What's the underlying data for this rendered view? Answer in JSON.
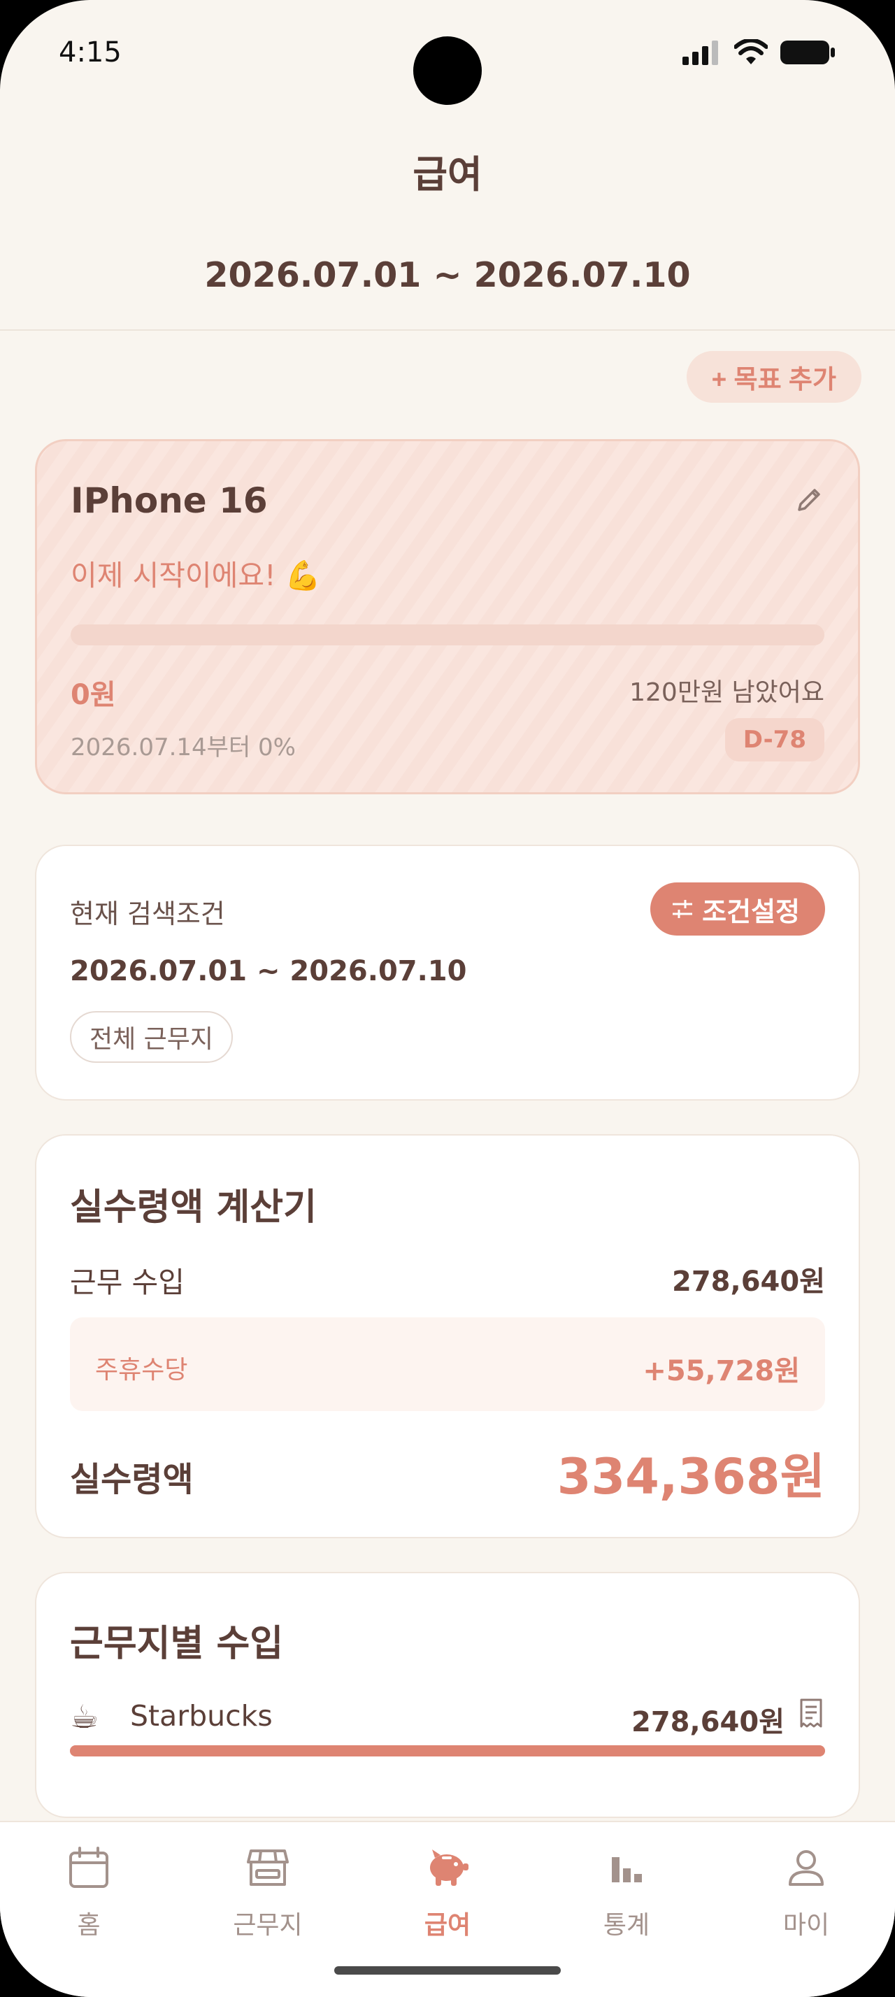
{
  "status": {
    "time": "4:15"
  },
  "header": {
    "title": "급여",
    "period": "2026.07.01 ~ 2026.07.10"
  },
  "goal": {
    "add_button": "+ 목표 추가",
    "name": "IPhone 16",
    "message": "이제 시작이에요! 💪",
    "progress_percent": 0,
    "current": "0원",
    "remaining": "120만원 남았어요",
    "start_info": "2026.07.14부터  0%",
    "dday": "D-78"
  },
  "filter": {
    "label": "현재 검색조건",
    "button": "조건설정",
    "range": "2026.07.01 ~ 2026.07.10",
    "chip": "전체 근무지"
  },
  "calculator": {
    "title": "실수령액 계산기",
    "work_income_label": "근무 수입",
    "work_income_value": "278,640원",
    "allowance_label": "주휴수당",
    "allowance_value": "+55,728원",
    "net_label": "실수령액",
    "net_value": "334,368원"
  },
  "workplace_income": {
    "title": "근무지별 수입",
    "items": [
      {
        "icon": "☕",
        "name": "Starbucks",
        "amount": "278,640원",
        "share_percent": 100
      }
    ]
  },
  "tabs": [
    {
      "label": "홈",
      "icon": "calendar-icon",
      "active": false
    },
    {
      "label": "근무지",
      "icon": "store-icon",
      "active": false
    },
    {
      "label": "급여",
      "icon": "piggy-bank-icon",
      "active": true
    },
    {
      "label": "통계",
      "icon": "bar-chart-icon",
      "active": false
    },
    {
      "label": "마이",
      "icon": "person-icon",
      "active": false
    }
  ],
  "colors": {
    "accent": "#de8472",
    "text": "#5b3f38",
    "background": "#f9f5ef"
  }
}
